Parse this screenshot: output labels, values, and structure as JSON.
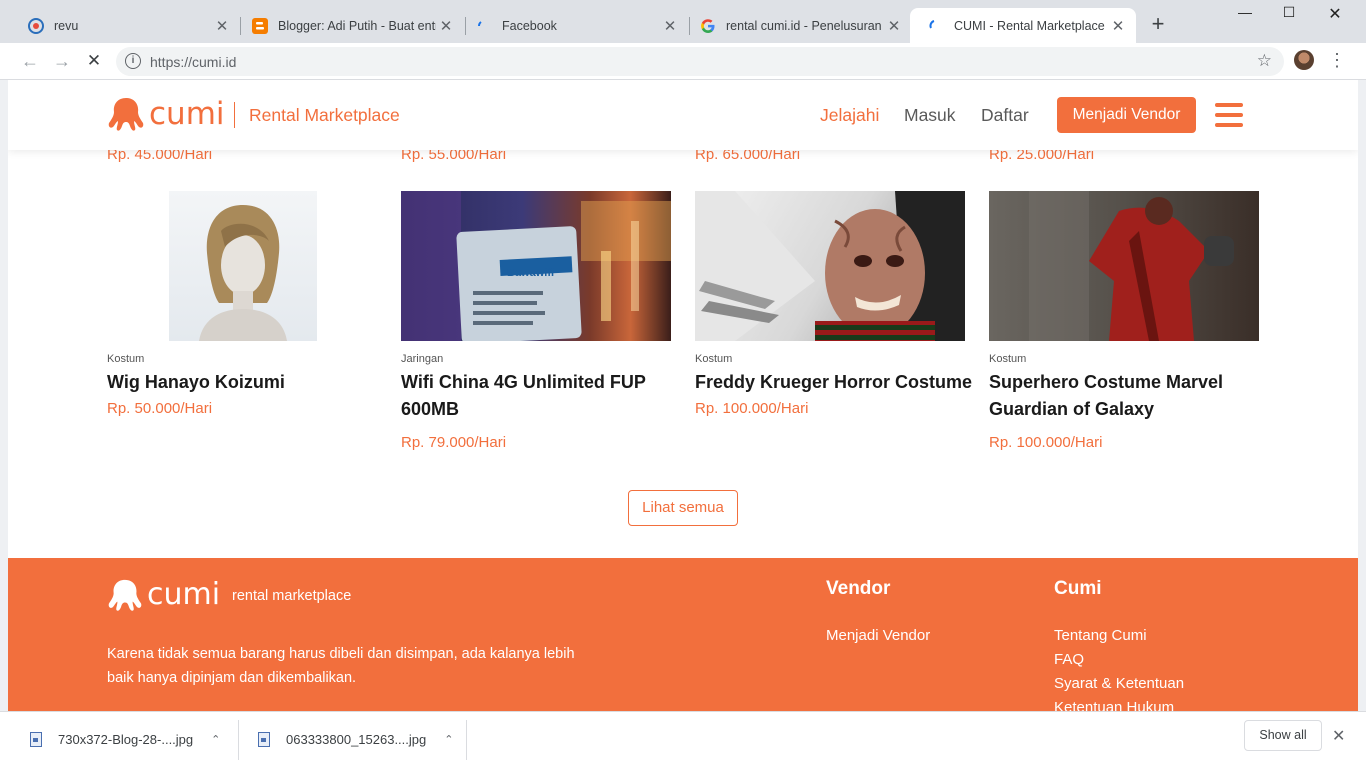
{
  "browser": {
    "tabs": [
      {
        "title": "revu"
      },
      {
        "title": "Blogger: Adi Putih - Buat entri"
      },
      {
        "title": "Facebook"
      },
      {
        "title": "rental cumi.id - Penelusuran G"
      },
      {
        "title": "CUMI - Rental Marketplace"
      }
    ],
    "url": "https://cumi.id"
  },
  "site": {
    "logo_text": "cumi",
    "tagline": "Rental Marketplace",
    "nav": {
      "explore": "Jelajahi",
      "login": "Masuk",
      "register": "Daftar",
      "become_vendor": "Menjadi Vendor"
    },
    "brand_color": "#f26f3d"
  },
  "prev_prices": [
    "Rp. 45.000/Hari",
    "Rp. 55.000/Hari",
    "Rp. 65.000/Hari",
    "Rp. 25.000/Hari"
  ],
  "products": [
    {
      "category": "Kostum",
      "name": "Wig Hanayo Koizumi",
      "price": "Rp. 50.000/Hari"
    },
    {
      "category": "Jaringan",
      "name": "Wifi China 4G Unlimited FUP 600MB",
      "price": "Rp. 79.000/Hari",
      "photo_text": "Bawawifi"
    },
    {
      "category": "Kostum",
      "name": "Freddy Krueger Horror Costume",
      "price": "Rp. 100.000/Hari"
    },
    {
      "category": "Kostum",
      "name": "Superhero Costume Marvel Guardian of Galaxy",
      "price": "Rp. 100.000/Hari"
    }
  ],
  "see_all": "Lihat semua",
  "footer": {
    "logo_text": "cumi",
    "tagline": "rental marketplace",
    "description": "Karena tidak semua barang harus dibeli dan disimpan, ada kalanya lebih baik hanya dipinjam dan dikembalikan.",
    "vendor_heading": "Vendor",
    "vendor_links": [
      "Menjadi Vendor"
    ],
    "cumi_heading": "Cumi",
    "cumi_links": [
      "Tentang Cumi",
      "FAQ",
      "Syarat & Ketentuan",
      "Ketentuan Hukum"
    ]
  },
  "downloads": {
    "items": [
      "730x372-Blog-28-....jpg",
      "063333800_15263....jpg"
    ],
    "show_all": "Show all"
  }
}
